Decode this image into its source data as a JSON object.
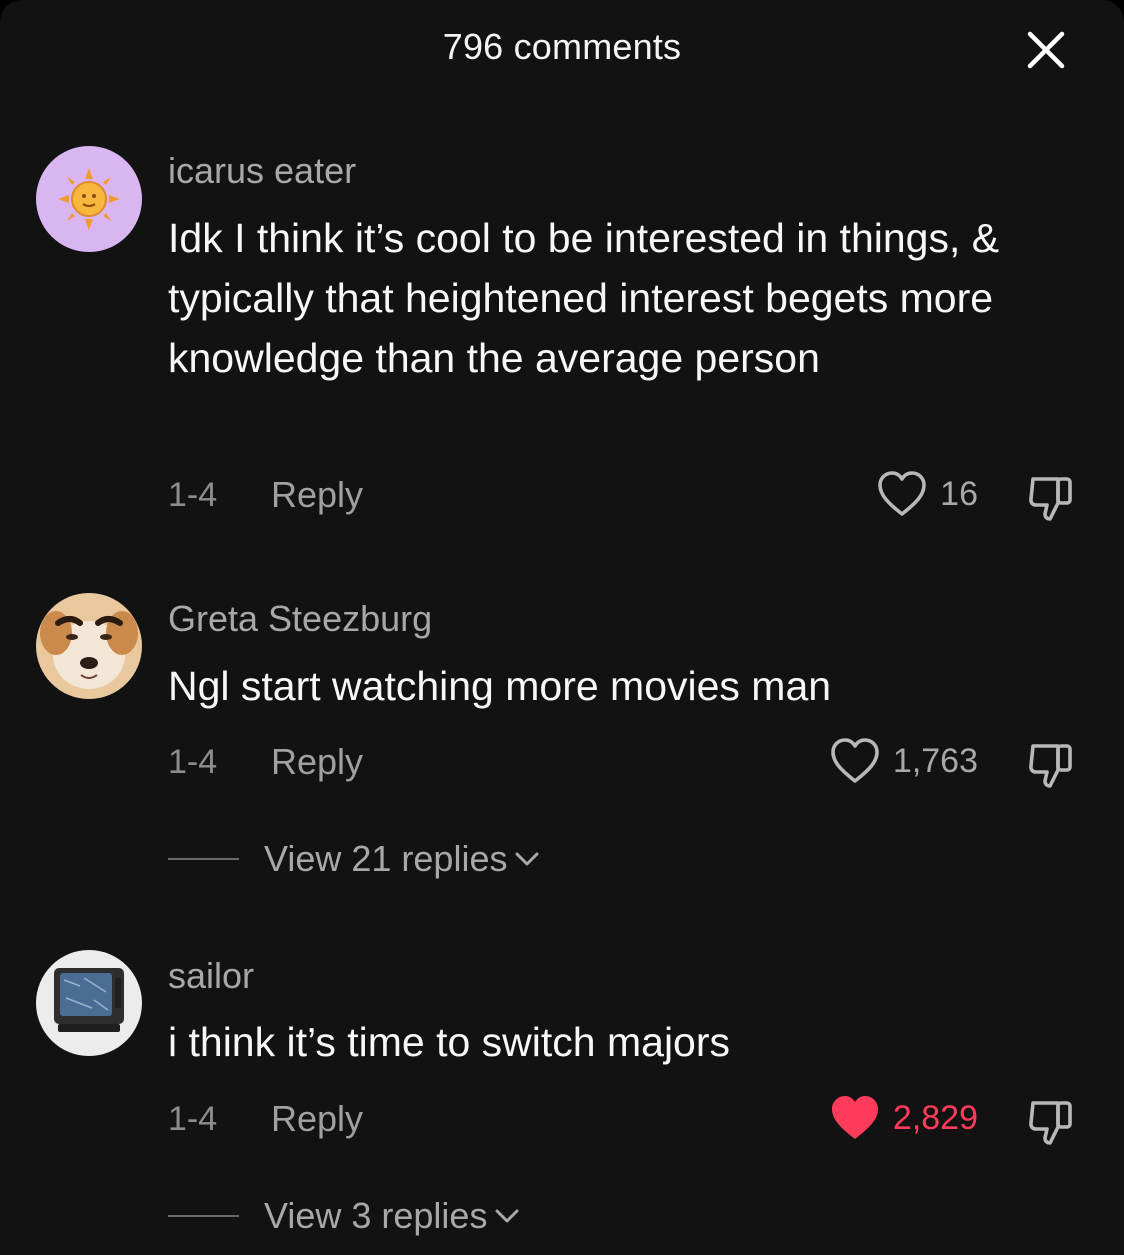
{
  "header": {
    "title": "796 comments"
  },
  "icons": {
    "close": "close-icon",
    "like": "heart-outline-icon",
    "liked": "heart-filled-icon",
    "dislike": "thumbs-down-icon",
    "expand": "chevron-down-icon"
  },
  "colors": {
    "background": "#121212",
    "liked": "#ff3b5c"
  },
  "comments": [
    {
      "username": "icarus eater",
      "text": "Idk I think it’s cool to be interested in things, & typically that heightened interest begets more knowledge than the average person",
      "date": "1-4",
      "reply_label": "Reply",
      "likes": "16",
      "liked": false
    },
    {
      "username": "Greta Steezburg",
      "text": "Ngl start watching more movies man",
      "date": "1-4",
      "reply_label": "Reply",
      "likes": "1,763",
      "liked": false,
      "view_replies": "View 21 replies"
    },
    {
      "username": "sailor",
      "text": "i think it’s time to switch majors",
      "date": "1-4",
      "reply_label": "Reply",
      "likes": "2,829",
      "liked": true,
      "view_replies": "View 3 replies"
    }
  ]
}
